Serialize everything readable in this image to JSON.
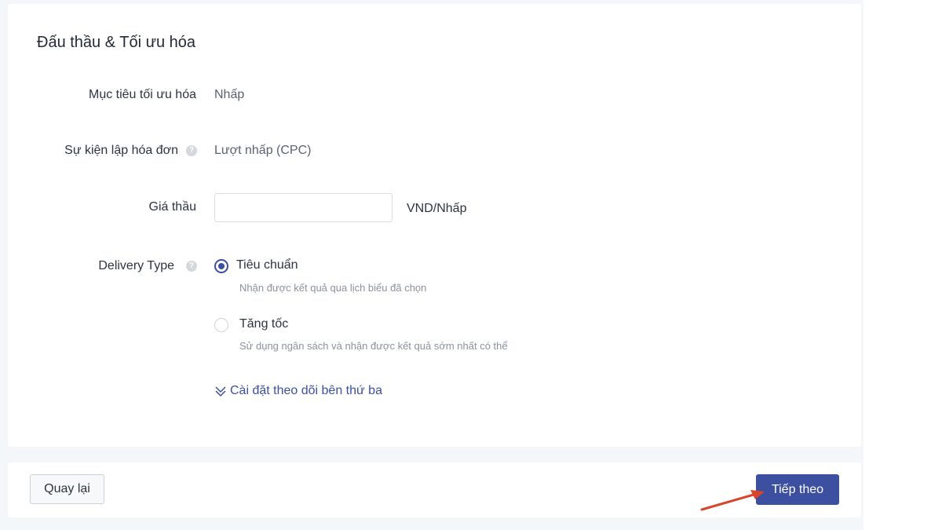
{
  "section": {
    "title": "Đấu thầu & Tối ưu hóa"
  },
  "fields": {
    "optimization_goal": {
      "label": "Mục tiêu tối ưu hóa",
      "value": "Nhấp"
    },
    "billing_event": {
      "label": "Sự kiện lập hóa đơn",
      "value": "Lượt nhấp (CPC)"
    },
    "bid": {
      "label": "Giá thầu",
      "input_value": "",
      "unit": "VND/Nhấp"
    },
    "delivery_type": {
      "label": "Delivery Type",
      "options": [
        {
          "label": "Tiêu chuẩn",
          "description": "Nhận được kết quả qua lịch biểu đã chọn",
          "selected": true
        },
        {
          "label": "Tăng tốc",
          "description": "Sử dụng ngân sách và nhận được kết quả sớm nhất có thể",
          "selected": false
        }
      ]
    }
  },
  "third_party_link": {
    "label": "Cài đặt theo dõi bên thứ ba",
    "icon": "double-chevron-down-icon"
  },
  "footer": {
    "back_label": "Quay lại",
    "next_label": "Tiếp theo"
  },
  "colors": {
    "primary": "#3c4fa0",
    "background": "#f4f7fa",
    "annotation_arrow": "#d9442c"
  }
}
